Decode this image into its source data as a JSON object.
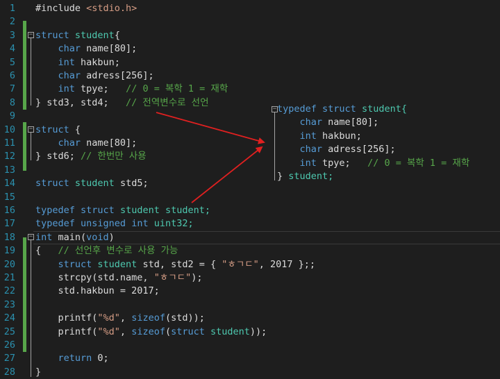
{
  "editor": {
    "line_numbers": [
      "1",
      "2",
      "3",
      "4",
      "5",
      "6",
      "7",
      "8",
      "9",
      "10",
      "11",
      "12",
      "13",
      "14",
      "15",
      "16",
      "17",
      "18",
      "19",
      "20",
      "21",
      "22",
      "23",
      "24",
      "25",
      "26",
      "27",
      "28"
    ],
    "lines": [
      [
        {
          "t": "#include ",
          "c": "id"
        },
        {
          "t": "<stdio.h>",
          "c": "str"
        }
      ],
      [],
      [
        {
          "t": "struct ",
          "c": "kw"
        },
        {
          "t": "student",
          "c": "type"
        },
        {
          "t": "{",
          "c": "id"
        }
      ],
      [
        {
          "t": "    char ",
          "c": "kw"
        },
        {
          "t": "name[80];",
          "c": "id"
        }
      ],
      [
        {
          "t": "    int ",
          "c": "kw"
        },
        {
          "t": "hakbun;",
          "c": "id"
        }
      ],
      [
        {
          "t": "    char ",
          "c": "kw"
        },
        {
          "t": "adress[256];",
          "c": "id"
        }
      ],
      [
        {
          "t": "    int ",
          "c": "kw"
        },
        {
          "t": "tpye;   ",
          "c": "id"
        },
        {
          "t": "// 0 = 복학 1 = 재학",
          "c": "cm"
        }
      ],
      [
        {
          "t": "} std3, std4;   ",
          "c": "id"
        },
        {
          "t": "// 전역변수로 선언",
          "c": "cm"
        }
      ],
      [],
      [
        {
          "t": "struct ",
          "c": "kw"
        },
        {
          "t": "{",
          "c": "id"
        }
      ],
      [
        {
          "t": "    char ",
          "c": "kw"
        },
        {
          "t": "name[80];",
          "c": "id"
        }
      ],
      [
        {
          "t": "} std6; ",
          "c": "id"
        },
        {
          "t": "// 한번만 사용",
          "c": "cm"
        }
      ],
      [],
      [
        {
          "t": "struct ",
          "c": "kw"
        },
        {
          "t": "student ",
          "c": "type"
        },
        {
          "t": "std5;",
          "c": "id"
        }
      ],
      [],
      [
        {
          "t": "typedef ",
          "c": "kw"
        },
        {
          "t": "struct ",
          "c": "kw"
        },
        {
          "t": "student student;",
          "c": "type"
        }
      ],
      [
        {
          "t": "typedef ",
          "c": "kw"
        },
        {
          "t": "unsigned ",
          "c": "kw"
        },
        {
          "t": "int ",
          "c": "kw"
        },
        {
          "t": "uint32;",
          "c": "type"
        }
      ],
      [
        {
          "t": "int ",
          "c": "kw"
        },
        {
          "t": "main(",
          "c": "id"
        },
        {
          "t": "void",
          "c": "kw"
        },
        {
          "t": ")",
          "c": "id"
        }
      ],
      [
        {
          "t": "{   ",
          "c": "id"
        },
        {
          "t": "// 선언후 변수로 사용 가능",
          "c": "cm"
        }
      ],
      [
        {
          "t": "    struct ",
          "c": "kw"
        },
        {
          "t": "student ",
          "c": "type"
        },
        {
          "t": "std, std2 = { ",
          "c": "id"
        },
        {
          "t": "\"ㅎㄱㄷ\"",
          "c": "str"
        },
        {
          "t": ", 2017 };;",
          "c": "id"
        }
      ],
      [
        {
          "t": "    strcpy(std.name, ",
          "c": "id"
        },
        {
          "t": "\"ㅎㄱㄷ\"",
          "c": "str"
        },
        {
          "t": ");",
          "c": "id"
        }
      ],
      [
        {
          "t": "    std.hakbun = 2017;",
          "c": "id"
        }
      ],
      [],
      [
        {
          "t": "    printf(",
          "c": "id"
        },
        {
          "t": "\"%d\"",
          "c": "str"
        },
        {
          "t": ", ",
          "c": "id"
        },
        {
          "t": "sizeof",
          "c": "kw"
        },
        {
          "t": "(std));",
          "c": "id"
        }
      ],
      [
        {
          "t": "    printf(",
          "c": "id"
        },
        {
          "t": "\"%d\"",
          "c": "str"
        },
        {
          "t": ", ",
          "c": "id"
        },
        {
          "t": "sizeof",
          "c": "kw"
        },
        {
          "t": "(",
          "c": "id"
        },
        {
          "t": "struct ",
          "c": "kw"
        },
        {
          "t": "student",
          "c": "type"
        },
        {
          "t": "));",
          "c": "id"
        }
      ],
      [],
      [
        {
          "t": "    return ",
          "c": "kw"
        },
        {
          "t": "0;",
          "c": "id"
        }
      ],
      [
        {
          "t": "}",
          "c": "id"
        }
      ]
    ]
  },
  "popup": {
    "lines": [
      [
        {
          "t": "typedef ",
          "c": "kw"
        },
        {
          "t": "struct ",
          "c": "kw"
        },
        {
          "t": "student{",
          "c": "type"
        }
      ],
      [
        {
          "t": "    char ",
          "c": "kw"
        },
        {
          "t": "name[80];",
          "c": "id"
        }
      ],
      [
        {
          "t": "    int ",
          "c": "kw"
        },
        {
          "t": "hakbun;",
          "c": "id"
        }
      ],
      [
        {
          "t": "    char ",
          "c": "kw"
        },
        {
          "t": "adress[256];",
          "c": "id"
        }
      ],
      [
        {
          "t": "    int ",
          "c": "kw"
        },
        {
          "t": "tpye;   ",
          "c": "id"
        },
        {
          "t": "// 0 = 복학 1 = 재학",
          "c": "cm"
        }
      ],
      [
        {
          "t": "} ",
          "c": "id"
        },
        {
          "t": "student;",
          "c": "type"
        }
      ]
    ]
  },
  "colors": {
    "background": "#1e1e1e",
    "keyword": "#569cd6",
    "type": "#4ec9b0",
    "string": "#d69d85",
    "comment": "#57a64a",
    "line_number": "#2b91af",
    "arrow": "#e02020"
  }
}
